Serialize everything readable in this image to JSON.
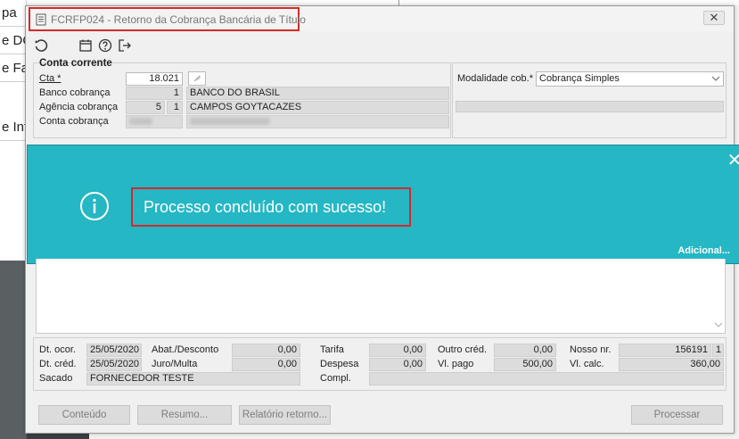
{
  "background": {
    "left_fragments": [
      "pa",
      "e DO",
      "e Fa",
      "e Int"
    ]
  },
  "window": {
    "title": "FCRFP024 - Retorno da Cobrança Bancária de Título",
    "close_glyph": "✕"
  },
  "conta_corrente": {
    "group_title": "Conta corrente",
    "cta_label": "Cta *",
    "cta_value": "18.021",
    "banco_label": "Banco cobrança",
    "banco_code": "1",
    "banco_name": "BANCO DO BRASIL",
    "agencia_label": "Agência cobrança",
    "agencia_code": "5",
    "agencia_digit": "1",
    "agencia_name": "CAMPOS GOYTACAZES",
    "conta_label": "Conta cobrança"
  },
  "modalidade": {
    "label": "Modalidade cob.*",
    "selected": "Cobrança Simples"
  },
  "notification": {
    "message": "Processo concluído com sucesso!",
    "more_link": "Adicional...",
    "close_glyph": "✕"
  },
  "details": {
    "dt_ocor_label": "Dt. ocor.",
    "dt_ocor_value": "25/05/2020",
    "dt_cred_label": "Dt. créd.",
    "dt_cred_value": "25/05/2020",
    "sacado_label": "Sacado",
    "sacado_value": "FORNECEDOR TESTE",
    "abat_label": "Abat./Desconto",
    "abat_value": "0,00",
    "juro_label": "Juro/Multa",
    "juro_value": "0,00",
    "tarifa_label": "Tarifa",
    "tarifa_value": "0,00",
    "despesa_label": "Despesa",
    "despesa_value": "0,00",
    "compl_label": "Compl.",
    "outro_label": "Outro créd.",
    "outro_value": "0,00",
    "vlpago_label": "Vl. pago",
    "vlpago_value": "500,00",
    "nosso_label": "Nosso nr.",
    "nosso_value": "156191",
    "nosso_digit": "1",
    "vlcalc_label": "Vl. calc.",
    "vlcalc_value": "360,00"
  },
  "buttons": {
    "conteudo": "Conteúdo",
    "resumo": "Resumo...",
    "relatorio": "Relatório retorno...",
    "processar": "Processar"
  },
  "colors": {
    "notification_bg": "#25b7c4",
    "highlight_border": "#d42a2a"
  }
}
